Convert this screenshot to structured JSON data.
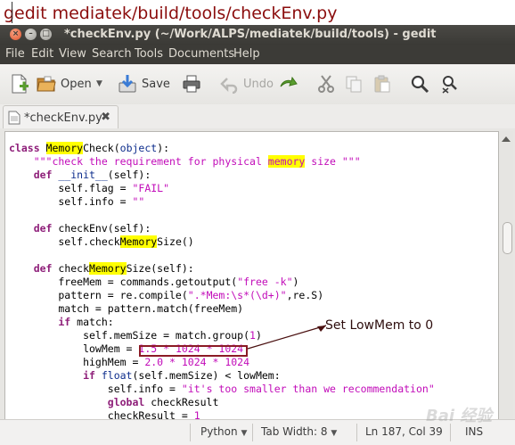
{
  "caption": "gedit mediatek/build/tools/checkEnv.py",
  "window": {
    "title": "*checkEnv.py (~/Work/ALPS/mediatek/build/tools) - gedit"
  },
  "menu": [
    "File",
    "Edit",
    "View",
    "Search",
    "Tools",
    "Documents",
    "Help"
  ],
  "toolbar": {
    "open_label": "Open",
    "save_label": "Save",
    "undo_label": "Undo"
  },
  "tab": {
    "label": "*checkEnv.py"
  },
  "code": {
    "l1_class": "class ",
    "l1_hl": "Memory",
    "l1_rest": "Check(",
    "l1_obj": "object",
    "l1_end": "):",
    "l2_q": "    \"\"\"check the requirement for physical ",
    "l2_hl": "memory",
    "l2_end": " size \"\"\"",
    "l3_def": "    def ",
    "l3_name": "__init__",
    "l3_end": "(self):",
    "l4_a": "        self.flag = ",
    "l4_s": "\"FAIL\"",
    "l5_a": "        self.info = ",
    "l5_s": "\"\"",
    "l7_def": "    def ",
    "l7_name": "checkEnv",
    "l7_end": "(self):",
    "l8_a": "        self.check",
    "l8_hl": "Memory",
    "l8_end": "Size()",
    "l10_def": "    def ",
    "l10_name": "check",
    "l10_hl": "Memory",
    "l10_end": "Size(self):",
    "l11_a": "        freeMem = commands.getoutput(",
    "l11_s": "\"free -k\"",
    "l11_end": ")",
    "l12_a": "        pattern = re.compile(",
    "l12_s": "\".*Mem:\\s*(\\d+)\"",
    "l12_end": ",re.S)",
    "l13": "        match = pattern.match(freeMem)",
    "l14_if": "        if ",
    "l14_end": "match:",
    "l15_a": "            self.memSize = match.group(",
    "l15_n": "1",
    "l15_end": ")",
    "l16_a": "            lowMem = ",
    "l16_n": "1.5 * 1024 * 1024",
    "l17_a": "            highMem = ",
    "l17_n": "2.0 * 1024 * 1024",
    "l18_if": "            if ",
    "l18_f": "float",
    "l18_end": "(self.memSize) < lowMem:",
    "l19_a": "                self.info = ",
    "l19_s": "\"it's too smaller than we recommendation\"",
    "l20_g": "                global ",
    "l20_end": "checkResult",
    "l21_a": "                checkResult = ",
    "l21_n": "1"
  },
  "annotation": "Set LowMem to 0",
  "status": {
    "language": "Python",
    "tab_width": "Tab Width:  8",
    "position": "Ln 187, Col 39",
    "mode": "INS"
  },
  "watermark": "Bai 经验"
}
